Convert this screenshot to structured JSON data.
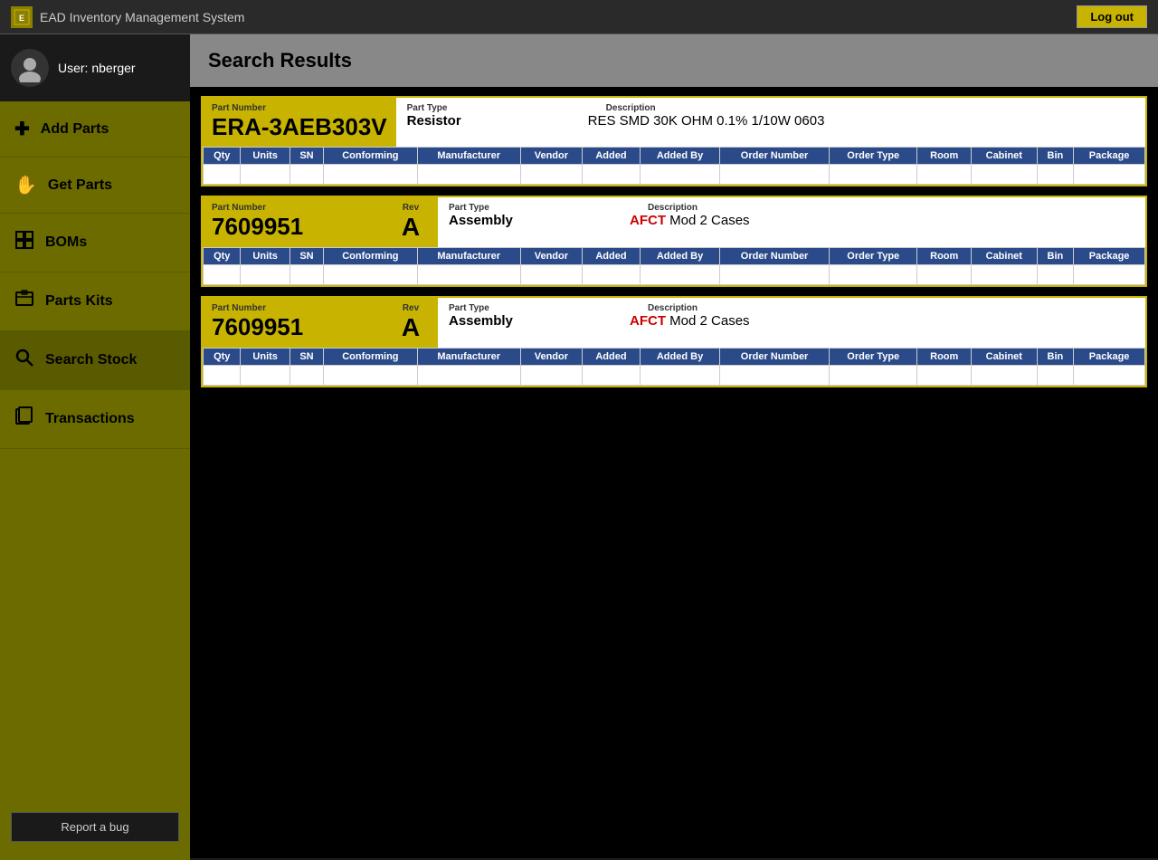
{
  "app": {
    "title": "EAD Inventory Management System",
    "icon_text": "EAD",
    "logout_label": "Log out"
  },
  "user": {
    "label": "User: nberger"
  },
  "sidebar": {
    "items": [
      {
        "id": "add-parts",
        "label": "Add Parts",
        "icon": "+"
      },
      {
        "id": "get-parts",
        "label": "Get Parts",
        "icon": "✋"
      },
      {
        "id": "boms",
        "label": "BOMs",
        "icon": "◈"
      },
      {
        "id": "parts-kits",
        "label": "Parts Kits",
        "icon": "🗂"
      },
      {
        "id": "search-stock",
        "label": "Search Stock",
        "icon": "🔍"
      },
      {
        "id": "transactions",
        "label": "Transactions",
        "icon": "📁"
      }
    ],
    "report_bug_label": "Report a bug"
  },
  "main": {
    "header": "Search Results"
  },
  "results": [
    {
      "id": "result-1",
      "part_number_label": "Part Number",
      "part_number": "ERA-3AEB303V",
      "has_rev": false,
      "rev": "",
      "part_type_label": "Part Type",
      "part_type": "Resistor",
      "description_label": "Description",
      "description": "RES SMD 30K OHM 0.1% 1/10W 0603",
      "description_red": "",
      "columns": [
        "Qty",
        "Units",
        "SN",
        "Conforming",
        "Manufacturer",
        "Vendor",
        "Added",
        "Added By",
        "Order Number",
        "Order Type",
        "Room",
        "Cabinet",
        "Bin",
        "Package"
      ],
      "rows": [
        [
          "",
          "",
          "",
          "",
          "",
          "",
          "",
          "",
          "",
          "",
          "",
          "",
          "",
          ""
        ]
      ]
    },
    {
      "id": "result-2",
      "part_number_label": "Part Number",
      "part_number": "7609951",
      "has_rev": true,
      "rev_label": "Rev",
      "rev": "A",
      "part_type_label": "Part Type",
      "part_type": "Assembly",
      "description_label": "Description",
      "description": "AFCT Mod 2 Cases",
      "description_red": "AFCT",
      "columns": [
        "Qty",
        "Units",
        "SN",
        "Conforming",
        "Manufacturer",
        "Vendor",
        "Added",
        "Added By",
        "Order Number",
        "Order Type",
        "Room",
        "Cabinet",
        "Bin",
        "Package"
      ],
      "rows": [
        [
          "",
          "",
          "",
          "",
          "",
          "",
          "",
          "",
          "",
          "",
          "",
          "",
          "",
          ""
        ]
      ]
    },
    {
      "id": "result-3",
      "part_number_label": "Part Number",
      "part_number": "7609951",
      "has_rev": true,
      "rev_label": "Rev",
      "rev": "A",
      "part_type_label": "Part Type",
      "part_type": "Assembly",
      "description_label": "Description",
      "description": "AFCT Mod 2 Cases",
      "description_red": "AFCT",
      "columns": [
        "Qty",
        "Units",
        "SN",
        "Conforming",
        "Manufacturer",
        "Vendor",
        "Added",
        "Added By",
        "Order Number",
        "Order Type",
        "Room",
        "Cabinet",
        "Bin",
        "Package"
      ],
      "rows": [
        [
          "",
          "",
          "",
          "",
          "",
          "",
          "",
          "",
          "",
          "",
          "",
          "",
          "",
          ""
        ]
      ]
    }
  ]
}
